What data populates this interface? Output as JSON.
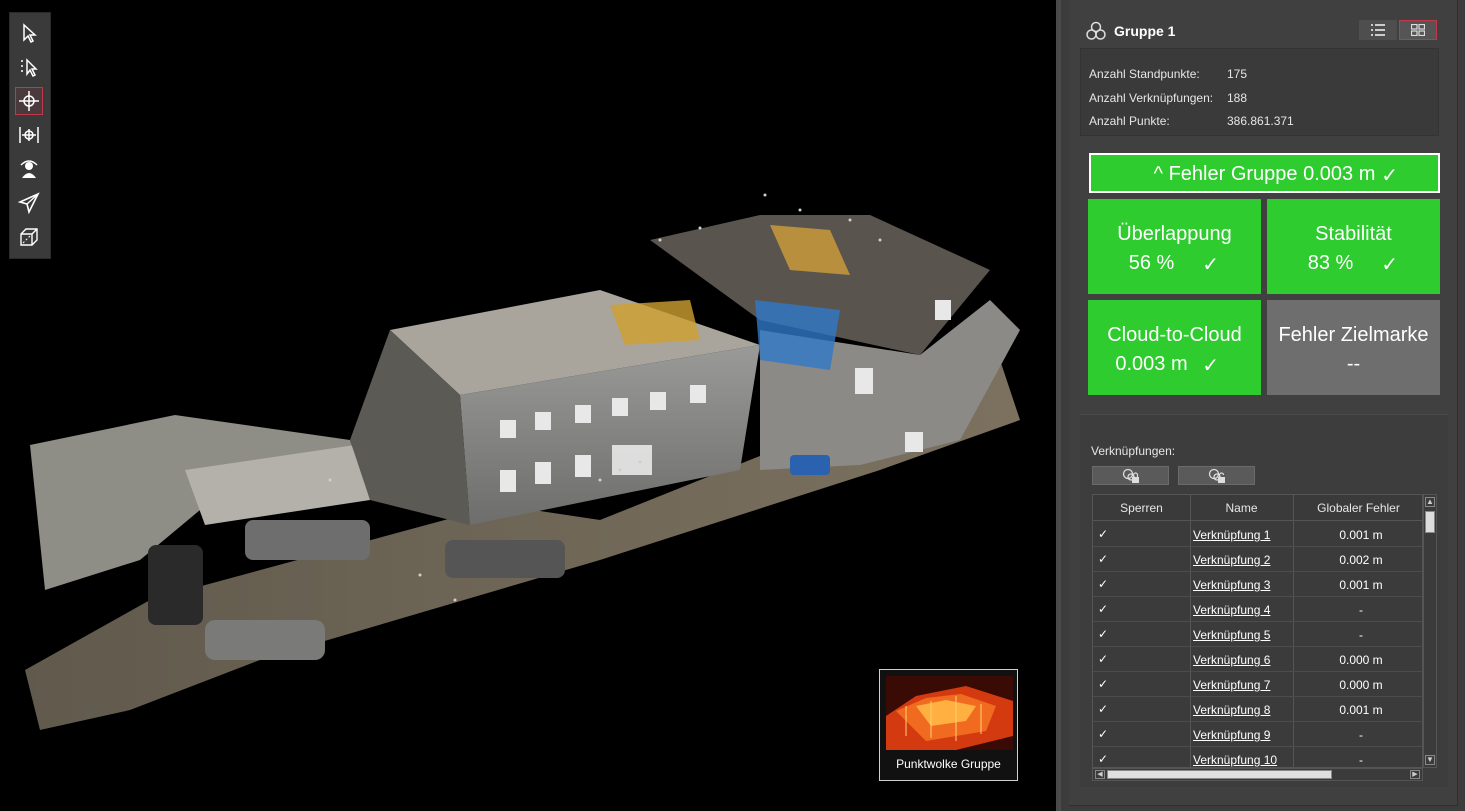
{
  "toolbar": {
    "tools": [
      {
        "icon": "select-arrow-icon"
      },
      {
        "icon": "multi-select-arrow-icon"
      },
      {
        "icon": "orbit-icon",
        "active": true
      },
      {
        "icon": "pan-horizontal-icon"
      },
      {
        "icon": "walk-person-icon"
      },
      {
        "icon": "fly-navigate-icon"
      },
      {
        "icon": "box-perspective-icon"
      }
    ]
  },
  "thumbnail": {
    "caption": "Punktwolke Gruppe"
  },
  "group": {
    "title": "Gruppe 1",
    "stats": [
      {
        "label": "Anzahl Standpunkte:",
        "value": "175"
      },
      {
        "label": "Anzahl Verknüpfungen:",
        "value": "188"
      },
      {
        "label": "Anzahl Punkte:",
        "value": "386.861.371"
      }
    ]
  },
  "quality": {
    "error_bar": "^ Fehler Gruppe 0.003 m",
    "check": "✓",
    "tiles": [
      {
        "title": "Überlappung",
        "value": "56 %",
        "check": "✓",
        "status": "ok"
      },
      {
        "title": "Stabilität",
        "value": "83 %",
        "check": "✓",
        "status": "ok"
      },
      {
        "title": "Cloud-to-Cloud",
        "value": "0.003 m",
        "check": "✓",
        "status": "ok"
      },
      {
        "title": "Fehler Zielmarke",
        "value": "--",
        "check": "",
        "status": "none"
      }
    ],
    "colors": {
      "ok": "#2ecc2e",
      "none": "#6e6e6e"
    }
  },
  "links": {
    "label": "Verknüpfungen:",
    "columns": [
      "Sperren",
      "Name",
      "Globaler Fehler"
    ],
    "rows": [
      {
        "locked": "✓",
        "name": "Verknüpfung 1",
        "error": "0.001 m"
      },
      {
        "locked": "✓",
        "name": "Verknüpfung 2",
        "error": "0.002 m"
      },
      {
        "locked": "✓",
        "name": "Verknüpfung 3",
        "error": "0.001 m"
      },
      {
        "locked": "✓",
        "name": "Verknüpfung 4",
        "error": "-"
      },
      {
        "locked": "✓",
        "name": "Verknüpfung 5",
        "error": "-"
      },
      {
        "locked": "✓",
        "name": "Verknüpfung 6",
        "error": "0.000 m"
      },
      {
        "locked": "✓",
        "name": "Verknüpfung 7",
        "error": "0.000 m"
      },
      {
        "locked": "✓",
        "name": "Verknüpfung 8",
        "error": "0.001 m"
      },
      {
        "locked": "✓",
        "name": "Verknüpfung 9",
        "error": "-"
      },
      {
        "locked": "✓",
        "name": "Verknüpfung 10",
        "error": "-"
      }
    ]
  }
}
